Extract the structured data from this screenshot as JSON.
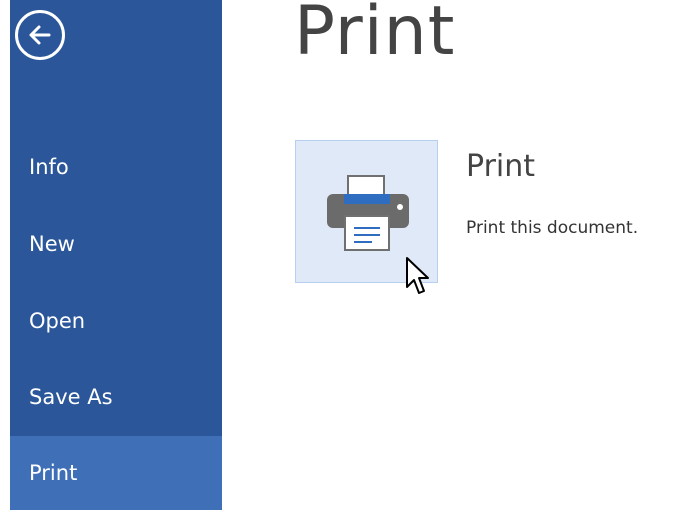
{
  "page": {
    "title": "Print"
  },
  "sidebar": {
    "back_icon": "back-arrow-circle-icon",
    "items": [
      {
        "label": "Info",
        "selected": false
      },
      {
        "label": "New",
        "selected": false
      },
      {
        "label": "Open",
        "selected": false
      },
      {
        "label": "Save As",
        "selected": false
      },
      {
        "label": "Print",
        "selected": true
      }
    ]
  },
  "print_section": {
    "icon": "printer-icon",
    "heading": "Print",
    "description": "Print this document."
  },
  "colors": {
    "sidebar_bg": "#2b579a",
    "sidebar_selected_bg": "#3f6fb6",
    "tile_bg": "#dfe9f7",
    "tile_border": "#b9cff0"
  }
}
